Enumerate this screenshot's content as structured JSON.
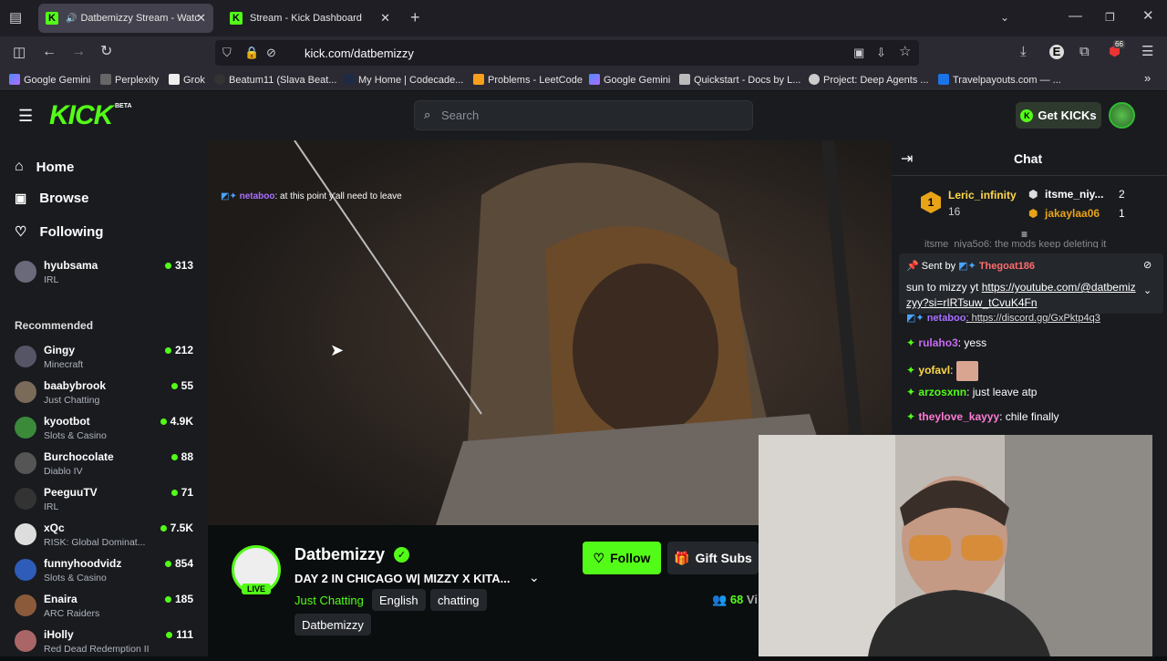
{
  "browser": {
    "tabs": [
      {
        "title": "Datbemizzy Stream - Watch",
        "active": true
      },
      {
        "title": "Stream - Kick Dashboard",
        "active": false
      }
    ],
    "url": "kick.com/datbemizzy",
    "ext_badge": "66",
    "bookmarks": [
      "Google Gemini",
      "Perplexity",
      "Grok",
      "Beatum11 (Slava Beat...",
      "My Home | Codecade...",
      "Problems - LeetCode",
      "Google Gemini",
      "Quickstart - Docs by L...",
      "Project: Deep Agents ...",
      "Travelpayouts.com — ..."
    ]
  },
  "header": {
    "logo": "KICK",
    "beta": "BETA",
    "search_placeholder": "Search",
    "get_kicks": "Get KICKs"
  },
  "sidebar": {
    "nav": [
      "Home",
      "Browse",
      "Following"
    ],
    "following": [
      {
        "name": "hyubsama",
        "category": "IRL",
        "viewers": "313"
      }
    ],
    "recommended_title": "Recommended",
    "recommended": [
      {
        "name": "Gingy",
        "category": "Minecraft",
        "viewers": "212"
      },
      {
        "name": "baabybrook",
        "category": "Just Chatting",
        "viewers": "55"
      },
      {
        "name": "kyootbot",
        "category": "Slots & Casino",
        "viewers": "4.9K"
      },
      {
        "name": "Burchocolate",
        "category": "Diablo IV",
        "viewers": "88"
      },
      {
        "name": "PeeguuTV",
        "category": "IRL",
        "viewers": "71"
      },
      {
        "name": "xQc",
        "category": "RISK: Global Dominat...",
        "viewers": "7.5K"
      },
      {
        "name": "funnyhoodvidz",
        "category": "Slots & Casino",
        "viewers": "854"
      },
      {
        "name": "Enaira",
        "category": "ARC Raiders",
        "viewers": "185"
      },
      {
        "name": "iHolly",
        "category": "Red Dead Redemption II",
        "viewers": "111"
      }
    ]
  },
  "video": {
    "overlay_user": "netaboo",
    "overlay_msg": ": at this point y'all need to leave"
  },
  "stream": {
    "channel": "Datbemizzy",
    "live": "LIVE",
    "title": "DAY 2 IN CHICAGO W| MIZZY X KITA...",
    "category": "Just Chatting",
    "tags": [
      "English",
      "chatting",
      "Datbemizzy"
    ],
    "follow": "Follow",
    "gift_subs": "Gift Subs",
    "viewers": "68",
    "viewers_suffix": "Vi"
  },
  "chat": {
    "title": "Chat",
    "leaderboard": [
      {
        "rank": "1",
        "name": "Leric_infinity",
        "count": "16"
      },
      {
        "name": "itsme_niy...",
        "count": "2"
      },
      {
        "name": "jakaylaa06",
        "count": "1"
      }
    ],
    "partial_top": "itsme_niya5o6: the mods keep deleting it",
    "pinned": {
      "sent_by": "Sent by",
      "user": "Thegoat186",
      "text": "sun to mizzy yt ",
      "link": "https://youtube.com/@datbemizzyy?si=rIRTsuw_tCvuK4Fn"
    },
    "messages": [
      {
        "user": "netaboo",
        "text": ": https://discord.gg/GxPktp4q3",
        "color": "#a970ff"
      },
      {
        "user": "rulaho3",
        "text": ": yess",
        "color": "#c86bf0"
      },
      {
        "user": "yofavl",
        "text": ":",
        "color": "#ffd84a"
      },
      {
        "user": "arzosxnn",
        "text": ": just leave atp",
        "color": "#53fc18"
      },
      {
        "user": "theylove_kayyy",
        "text": ": chile finally",
        "color": "#ff7bd5"
      }
    ]
  },
  "colors": {
    "accent": "#53fc18",
    "bg": "#0b0e0f",
    "panel": "#191b1f"
  }
}
